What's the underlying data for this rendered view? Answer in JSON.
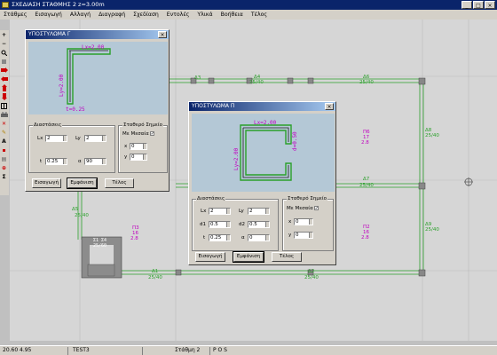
{
  "window": {
    "title": "ΣΧΕΔΙΑΣΗ ΣΤΑΘΜΗΣ 2   z=3.00m",
    "btn_min": "_",
    "btn_max": "□",
    "btn_close": "×"
  },
  "menu": [
    "Στάθμες",
    "Εισαγωγή",
    "Αλλαγή",
    "Διαγραφή",
    "Σχεδίαση",
    "Εντολές",
    "Υλικά",
    "Βοήθεια",
    "Τέλος"
  ],
  "canvas": {
    "beam_labels": [
      {
        "id": "b3",
        "name": "Δ3",
        "size": "25/40"
      },
      {
        "id": "b4",
        "name": "Δ4",
        "size": "25/40"
      },
      {
        "id": "b6",
        "name": "Δ6",
        "size": "25/40"
      },
      {
        "id": "b7",
        "name": "Δ7",
        "size": "25/40"
      },
      {
        "id": "b8",
        "name": "Δ8",
        "size": "25/40"
      },
      {
        "id": "b9",
        "name": "Δ9",
        "size": "25/40"
      },
      {
        "id": "b1",
        "name": "Δ1",
        "size": "25/40"
      },
      {
        "id": "b2",
        "name": "Δ2",
        "size": "25/40"
      },
      {
        "id": "bv",
        "name": "Δ5",
        "size": "25/40"
      }
    ],
    "slabs": [
      {
        "name": "Π6",
        "v1": "17",
        "v2": "2.8"
      },
      {
        "name": "Π3",
        "v1": "16",
        "v2": "2.8"
      },
      {
        "name": "Π2",
        "v1": "16",
        "v2": "2.8"
      }
    ],
    "column_labels": [
      "Σ1 Σ4",
      "25/60"
    ]
  },
  "dialog1": {
    "title": "ΥΠΟΣΤΥΛΩΜΑ Γ",
    "close": "×",
    "preview_lx": "Lx=2.00",
    "preview_ly": "Ly=2.00",
    "preview_t": "t=0.25",
    "dims_title": "Διαστάσεις",
    "lx_label": "Lx",
    "lx_value": "2",
    "ly_label": "Ly",
    "ly_value": "2",
    "t_label": "t",
    "t_value": "0.25",
    "a_label": "α",
    "a_value": "90",
    "fixed_title": "Σταθερό Σημείο",
    "centroid_label": "Με Μεσαία",
    "x_label": "x",
    "x_value": "0",
    "y_label": "y",
    "y_value": "0",
    "insert": "Εισαγωγή",
    "show": "Εμφάνιση",
    "end": "Τέλος"
  },
  "dialog2": {
    "title": "ΥΠΟΣΤΥΛΩΜΑ Π",
    "close": "×",
    "preview_lx": "Lx=2.00",
    "preview_ly": "Ly=2.00",
    "preview_d": "d=0.50",
    "dims_title": "Διαστάσεις",
    "lx_label": "Lx",
    "lx_value": "2",
    "ly_label": "Ly",
    "ly_value": "2",
    "d1_label": "d1",
    "d1_value": "0.5",
    "d2_label": "d2",
    "d2_value": "0.5",
    "t_label": "t",
    "t_value": "0.25",
    "a_label": "α",
    "a_value": "0",
    "fixed_title": "Σταθερό Σημείο",
    "centroid_label": "Με Μεσαία",
    "x_label": "x",
    "x_value": "0",
    "y_label": "y",
    "y_value": "0",
    "insert": "Εισαγωγή",
    "show": "Εμφάνιση",
    "end": "Τέλος"
  },
  "status": {
    "x": "20.60",
    "y": "4.95",
    "project": "TEST3",
    "level": "Στάθμη 2",
    "mode": "P O S"
  }
}
